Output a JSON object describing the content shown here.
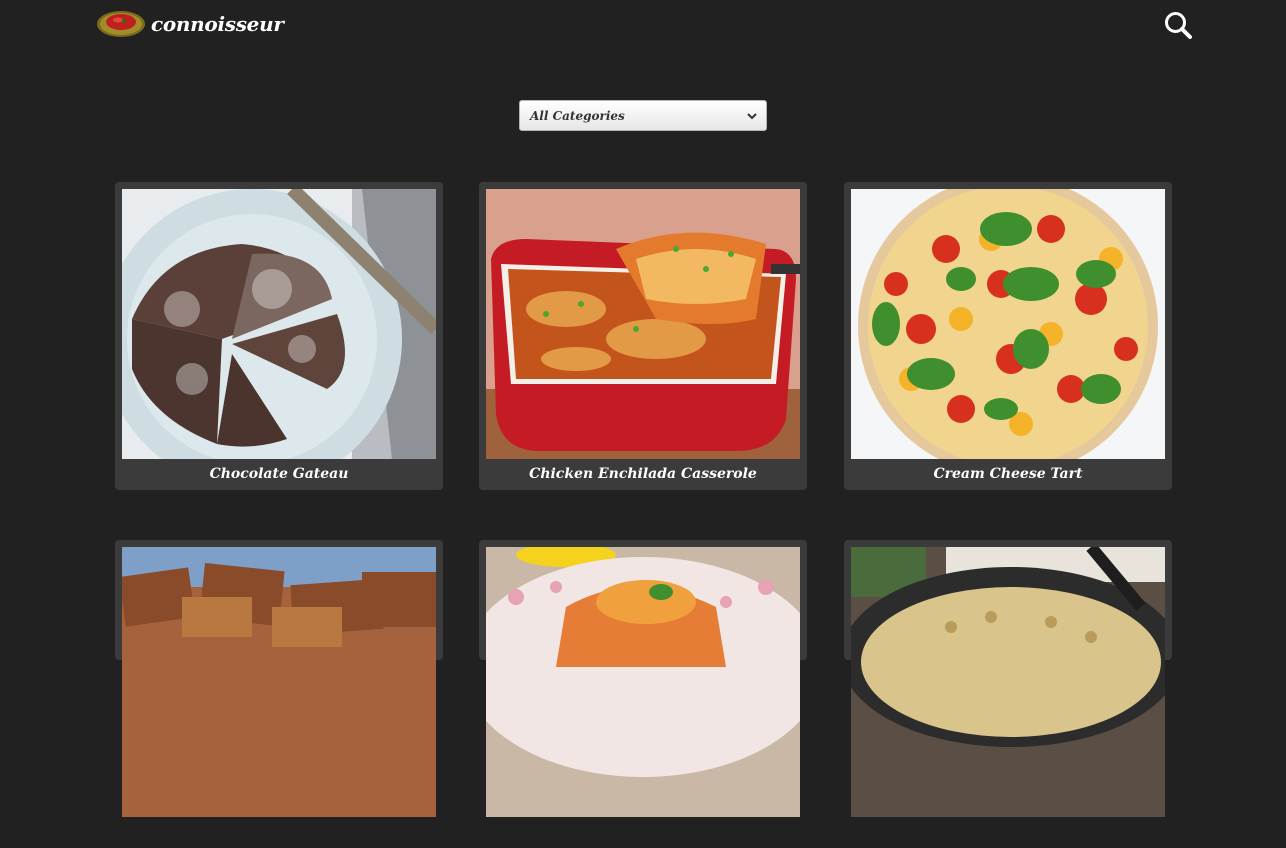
{
  "brand": {
    "name": "connoisseur",
    "logo_icon": "plate-logo-icon"
  },
  "header": {
    "search_icon": "search-icon"
  },
  "filter": {
    "selected": "All Categories",
    "chevron_icon": "chevron-down-icon"
  },
  "recipes": [
    {
      "title": "Chocolate Gateau"
    },
    {
      "title": "Chicken Enchilada Casserole"
    },
    {
      "title": "Cream Cheese Tart"
    },
    {
      "title": ""
    },
    {
      "title": ""
    },
    {
      "title": ""
    }
  ],
  "colors": {
    "background": "#212121",
    "card": "#3b3b3b",
    "text": "#ffffff"
  }
}
